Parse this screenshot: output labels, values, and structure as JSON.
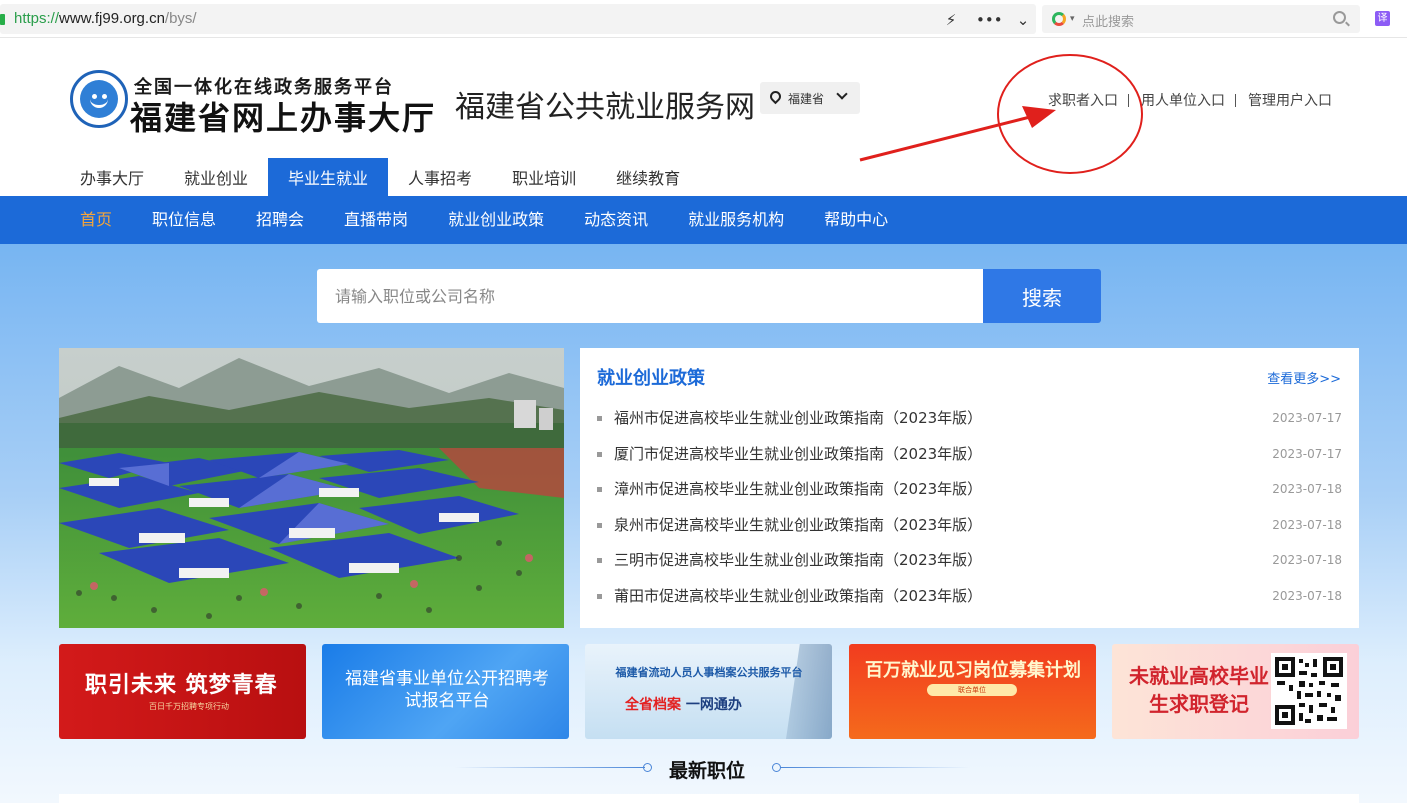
{
  "browser": {
    "url_protocol": "https://",
    "url_host": "www.fj99.org.cn",
    "url_path": "/bys/",
    "search_placeholder": "点此搜索",
    "translate_label": "译"
  },
  "header": {
    "brand_top": "全国一体化在线政务服务平台",
    "brand_main": "福建省网上办事大厅",
    "site_name": "福建省公共就业服务网",
    "region": "福建省",
    "entries": [
      "求职者入口",
      "用人单位入口",
      "管理用户入口"
    ]
  },
  "tabs": [
    {
      "label": "办事大厅",
      "active": false
    },
    {
      "label": "就业创业",
      "active": false
    },
    {
      "label": "毕业生就业",
      "active": true
    },
    {
      "label": "人事招考",
      "active": false
    },
    {
      "label": "职业培训",
      "active": false
    },
    {
      "label": "继续教育",
      "active": false
    }
  ],
  "nav": [
    {
      "label": "首页",
      "active": true
    },
    {
      "label": "职位信息",
      "active": false
    },
    {
      "label": "招聘会",
      "active": false
    },
    {
      "label": "直播带岗",
      "active": false
    },
    {
      "label": "就业创业政策",
      "active": false
    },
    {
      "label": "动态资讯",
      "active": false
    },
    {
      "label": "就业服务机构",
      "active": false
    },
    {
      "label": "帮助中心",
      "active": false
    }
  ],
  "search": {
    "placeholder": "请输入职位或公司名称",
    "button": "搜索"
  },
  "policy": {
    "title": "就业创业政策",
    "more": "查看更多>>",
    "items": [
      {
        "title": "福州市促进高校毕业生就业创业政策指南（2023年版）",
        "date": "2023-07-17"
      },
      {
        "title": "厦门市促进高校毕业生就业创业政策指南（2023年版）",
        "date": "2023-07-17"
      },
      {
        "title": "漳州市促进高校毕业生就业创业政策指南（2023年版）",
        "date": "2023-07-18"
      },
      {
        "title": "泉州市促进高校毕业生就业创业政策指南（2023年版）",
        "date": "2023-07-18"
      },
      {
        "title": "三明市促进高校毕业生就业创业政策指南（2023年版）",
        "date": "2023-07-18"
      },
      {
        "title": "莆田市促进高校毕业生就业创业政策指南（2023年版）",
        "date": "2023-07-18"
      }
    ]
  },
  "banners": {
    "b1_main": "职引未来  筑梦青春",
    "b1_sub": "百日千万招聘专项行动",
    "b2_main": "福建省事业单位公开招聘考试报名平台",
    "b3_head": "福建省流动人员人事档案公共服务平台",
    "b3_main_red": "全省档案",
    "b3_main_blue": " 一网通办",
    "b4_main": "百万就业见习岗位募集计划",
    "b4_pill": "联合单位",
    "b5_main": "未就业高校毕业生求职登记"
  },
  "section": {
    "latest_jobs": "最新职位"
  },
  "colors": {
    "brand_blue": "#1c6ad8",
    "nav_active": "#f5a53a",
    "annotation_red": "#e0201c"
  }
}
